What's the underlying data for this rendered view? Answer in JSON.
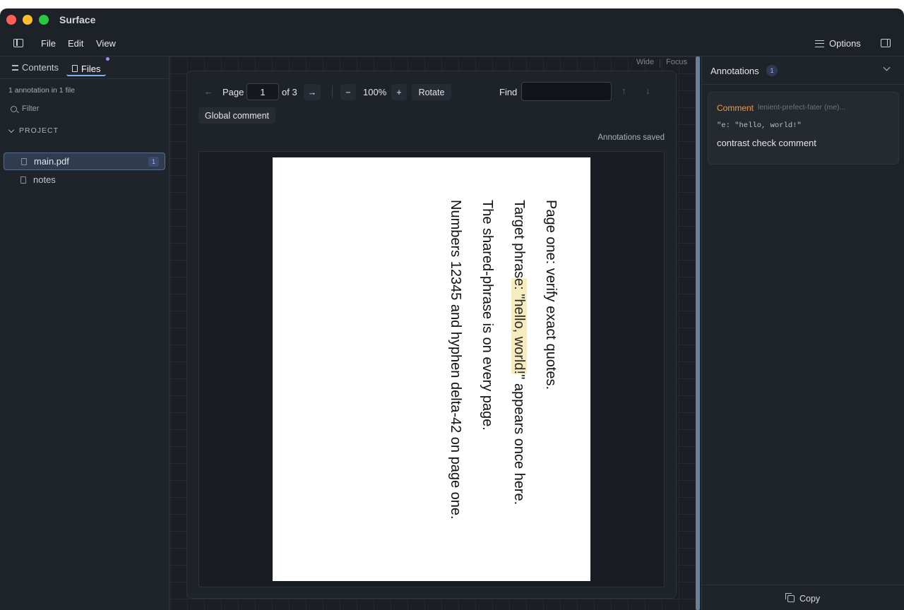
{
  "window": {
    "title": "Surface"
  },
  "menubar": {
    "items": [
      "File",
      "Edit",
      "View"
    ],
    "options_label": "Options"
  },
  "sidebar": {
    "tabs": [
      {
        "label": "Contents",
        "icon": "list-icon"
      },
      {
        "label": "Files",
        "icon": "file-icon",
        "active": true
      }
    ],
    "summary": "1 annotation in 1 file",
    "filter_placeholder": "Filter",
    "section_label": "PROJECT",
    "files": [
      {
        "name": "main.pdf",
        "count": "1",
        "active": true
      },
      {
        "name": "notes"
      }
    ]
  },
  "viewer": {
    "modes": [
      "Wide",
      "Focus"
    ],
    "page_label": "Page",
    "page_value": "1",
    "page_of": "of 3",
    "zoom_out": "−",
    "zoom": "100%",
    "zoom_in": "+",
    "rotate_label": "Rotate",
    "find_label": "Find",
    "find_value": "",
    "global_comment_label": "Global comment",
    "status": "Annotations saved",
    "document_lines": [
      {
        "text": "Page one: verify exact quotes."
      },
      {
        "before": "Target phras",
        "highlight": "e: \"hello, world!",
        "after": "\" appears once here."
      },
      {
        "text": "The shared-phrase is on every page."
      },
      {
        "text": "Numbers 12345 and hyphen delta-42 on page one."
      }
    ]
  },
  "annotations_panel": {
    "title": "Annotations",
    "count": "1",
    "items": [
      {
        "type": "Comment",
        "author": "lenient-prefect-fater (me)...",
        "quote": "\"e: \"hello, world!\"",
        "text": "contrast check comment"
      }
    ],
    "copy_label": "Copy"
  },
  "colors": {
    "accent": "#7fb0ff",
    "comment_type": "#f29a3e",
    "highlight": "#f7ecbe",
    "background": "#1d2128"
  }
}
